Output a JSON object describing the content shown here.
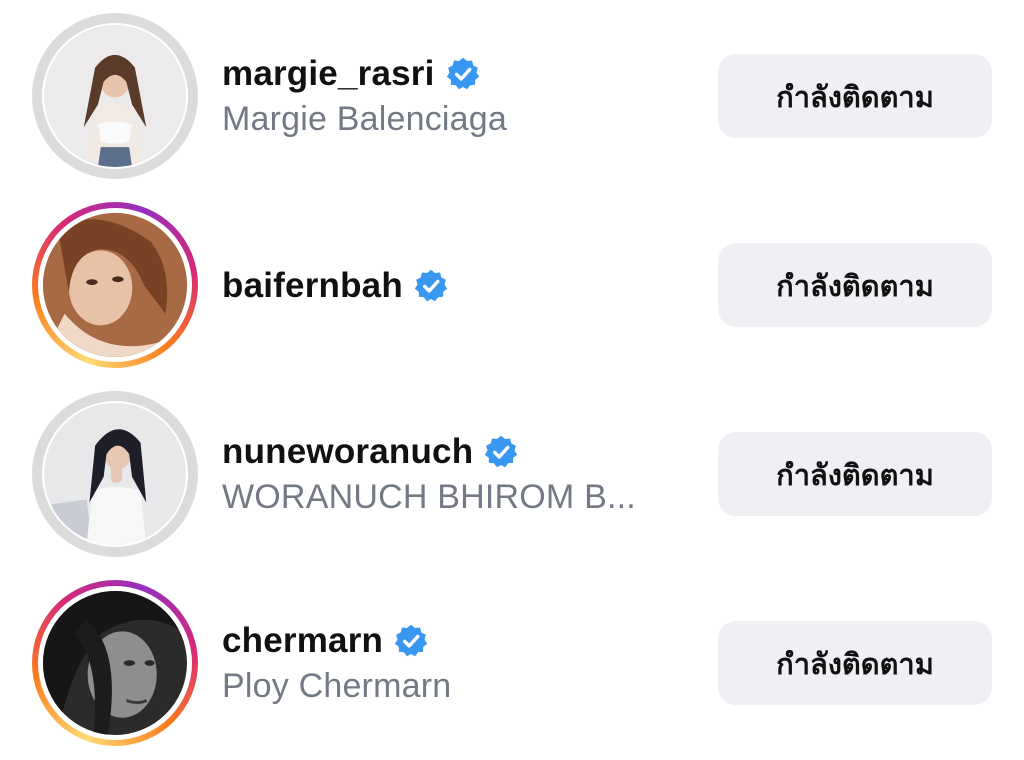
{
  "following_list": {
    "accounts": [
      {
        "username": "margie_rasri",
        "full_name": "Margie Balenciaga",
        "verified": true,
        "story_ring": false,
        "button_label": "กำลังติดตาม"
      },
      {
        "username": "baifernbah",
        "full_name": "",
        "verified": true,
        "story_ring": true,
        "button_label": "กำลังติดตาม"
      },
      {
        "username": "nuneworanuch",
        "full_name": "WORANUCH BHIROM B...",
        "verified": true,
        "story_ring": false,
        "button_label": "กำลังติดตาม"
      },
      {
        "username": "chermarn",
        "full_name": "Ploy Chermarn",
        "verified": true,
        "story_ring": true,
        "button_label": "กำลังติดตาม"
      }
    ]
  },
  "colors": {
    "verified_badge": "#3897f0",
    "button_bg": "#efeff4",
    "secondary_text": "#737985"
  },
  "icons": {
    "verified": "verified-badge-icon",
    "avatar": "profile-photo"
  }
}
